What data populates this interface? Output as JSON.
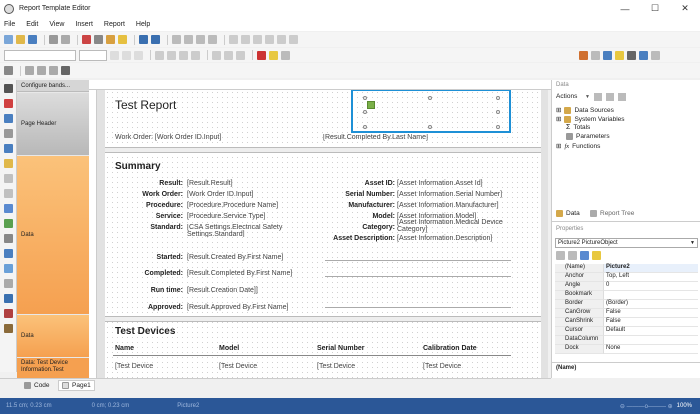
{
  "app": {
    "title": "Report Template Editor"
  },
  "menu": [
    "File",
    "Edit",
    "View",
    "Insert",
    "Report",
    "Help"
  ],
  "window_controls": [
    "—",
    "☐",
    "✕"
  ],
  "band_header_label": "Configure bands...",
  "bands": [
    "Page Header",
    "Data",
    "Data",
    "Data: Test Device Information.Test"
  ],
  "report": {
    "title": "Test Report",
    "header_fields": [
      "Work Order: [Work Order ID.Input]",
      "[Result.Completed By.Last Name]"
    ],
    "summary_title": "Summary",
    "left_rows": [
      {
        "label": "Result:",
        "value": "[Result.Result]"
      },
      {
        "label": "Work Order:",
        "value": "[Work Order ID.Input]"
      },
      {
        "label": "Procedure:",
        "value": "[Procedure.Procedure Name]"
      },
      {
        "label": "Service:",
        "value": "[Procedure.Service Type]"
      },
      {
        "label": "Standard:",
        "value": "[CSA Settings.Electrical Safety Settings.Standard]"
      }
    ],
    "right_rows": [
      {
        "label": "Asset ID:",
        "value": "[Asset Information.Asset Id]"
      },
      {
        "label": "Serial Number:",
        "value": "[Asset Information.Serial Number]"
      },
      {
        "label": "Manufacturer:",
        "value": "[Asset Information.Manufacturer]"
      },
      {
        "label": "Model:",
        "value": "[Asset Information.Model]"
      },
      {
        "label": "Category:",
        "value": "[Asset Information.Medical Device Category]"
      },
      {
        "label": "Asset Description:",
        "value": "[Asset Information.Description]"
      }
    ],
    "status_rows": [
      {
        "label": "Started:",
        "value": "[Result.Created By.First Name]"
      },
      {
        "label": "Completed:",
        "value": "[Result.Completed By.First Name]"
      },
      {
        "label": "Run time:",
        "value": "[Result.Creation Date]]"
      },
      {
        "label": "Approved:",
        "value": "[Result.Approved By.First Name]"
      }
    ],
    "devices_title": "Test Devices",
    "devices_columns": [
      "Name",
      "Model",
      "Serial Number",
      "Calibration Date"
    ],
    "devices_row": [
      "[Test Device",
      "[Test Device",
      "[Test Device",
      "[Test Device"
    ]
  },
  "data_panel": {
    "header": "Data",
    "actions_label": "Actions",
    "tree": [
      "Data Sources",
      "System Variables",
      "Totals",
      "Parameters",
      "Functions"
    ]
  },
  "panel_tabs": [
    "Data",
    "Report Tree"
  ],
  "properties": {
    "header": "Properties",
    "selected_object": "Picture2  PictureObject",
    "rows": [
      {
        "name": "(Name)",
        "value": "Picture2"
      },
      {
        "name": "Anchor",
        "value": "Top, Left"
      },
      {
        "name": "Angle",
        "value": "0"
      },
      {
        "name": "Bookmark",
        "value": ""
      },
      {
        "name": "Border",
        "value": "(Border)"
      },
      {
        "name": "CanGrow",
        "value": "False"
      },
      {
        "name": "CanShrink",
        "value": "False"
      },
      {
        "name": "Cursor",
        "value": "Default"
      },
      {
        "name": "DataColumn",
        "value": ""
      },
      {
        "name": "Dock",
        "value": "None"
      }
    ],
    "description": "(Name)"
  },
  "bottom_tabs": [
    "Code",
    "Page1"
  ],
  "status": {
    "pos1": "11.5 cm; 0.23 cm",
    "pos2": "0 cm; 0.23 cm",
    "object": "Picture2",
    "zoom": "100%"
  }
}
